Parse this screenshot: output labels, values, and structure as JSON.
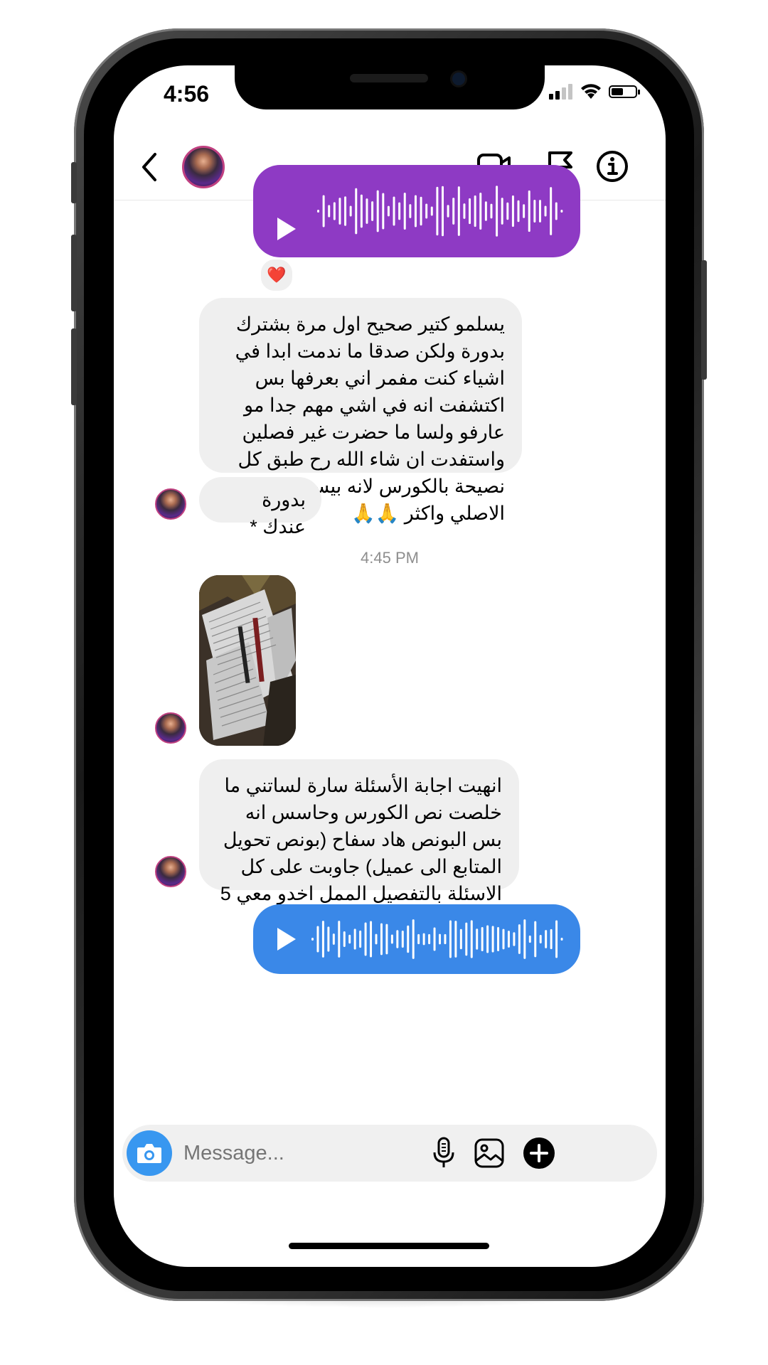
{
  "status_bar": {
    "time": "4:56"
  },
  "header": {
    "back_icon": "chevron-left-icon",
    "call_icon": "video-camera-icon",
    "report_icon": "flag-icon",
    "info_icon": "info-circle-icon"
  },
  "messages": {
    "voice_outgoing_1": {
      "color": "#8e3ac4",
      "reaction": "❤️"
    },
    "text_1": "يسلمو كتير صحيح اول مرة بشترك بدورة ولكن صدقا ما ندمت ابدا في اشياء كنت مفمر اني بعرفها بس اكتشفت انه في اشي مهم جدا مو عارفو ولسا ما حضرت غير فصلين واستفدت ان شاء الله رح طبق كل نصيحة بالكورس لانه بيستاهل سعره الاصلي واكثر 🙏🙏",
    "text_2": "بدورة عندك *",
    "timestamp": "4:45 PM",
    "text_3": "انهيت اجابة الأسئلة سارة لساتني ما خلصت نص الكورس وحاسس انه بس البونص هاد سفاح (بونص تحويل المتابع الى عميل) جاوبت على كل الاسئلة بالتفصيل الممل اخدو معي 5  صفحات ✌️",
    "voice_outgoing_2": {
      "color": "#3a88e8"
    }
  },
  "composer": {
    "placeholder": "Message...",
    "camera_icon": "camera-icon",
    "mic_icon": "microphone-icon",
    "gallery_icon": "image-icon",
    "add_icon": "plus-circle-icon"
  },
  "colors": {
    "accent": "#3897f0",
    "incoming_bubble": "#efefef"
  }
}
